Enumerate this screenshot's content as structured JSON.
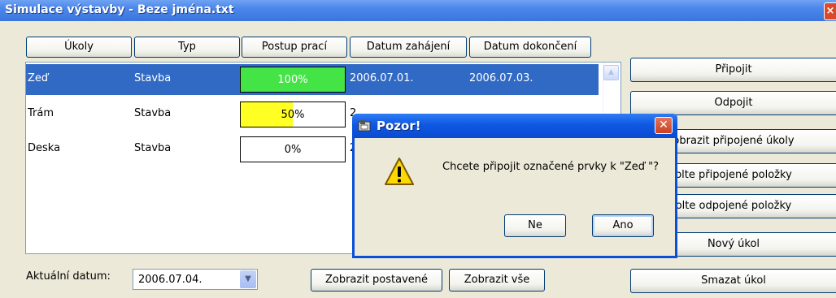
{
  "window": {
    "title": "Simulace výstavby - Beze jména.txt",
    "close_glyph": "×"
  },
  "columns": [
    "Úkoly",
    "Typ",
    "Postup prací",
    "Datum zahájení",
    "Datum dokončení"
  ],
  "rows": [
    {
      "task": "Zeď",
      "type": "Stavba",
      "progress_label": "100%",
      "progress": 100,
      "fill_color": "#44e346",
      "start": "2006.07.01.",
      "end": "2006.07.03.",
      "selected": true
    },
    {
      "task": "Trám",
      "type": "Stavba",
      "progress_label": "50%",
      "progress": 50,
      "fill_color": "#ffff24",
      "start": "2",
      "end": "",
      "selected": false
    },
    {
      "task": "Deska",
      "type": "Stavba",
      "progress_label": "0%",
      "progress": 0,
      "fill_color": "#ffffff",
      "start": "2",
      "end": "",
      "selected": false
    }
  ],
  "right_buttons": [
    "Připojit",
    "Odpojit",
    "obrazit připojené úkoly",
    "olte připojené položky",
    "olte odpojené položky",
    "Nový úkol",
    "Smazat úkol"
  ],
  "bottom": {
    "date_label": "Aktuální datum:",
    "date_value": "2006.07.04.",
    "show_built": "Zobrazit postavené",
    "show_all": "Zobrazit vše"
  },
  "dialog": {
    "title": "Pozor!",
    "message": "Chcete připojit označené prvky k \"Zeď \"?",
    "no": "Ne",
    "yes": "Ano",
    "close_glyph": "✕"
  },
  "colors": {
    "selection": "#316ac5",
    "titlebar": "#3b76dc",
    "dialog_frame": "#0a4fd8"
  }
}
